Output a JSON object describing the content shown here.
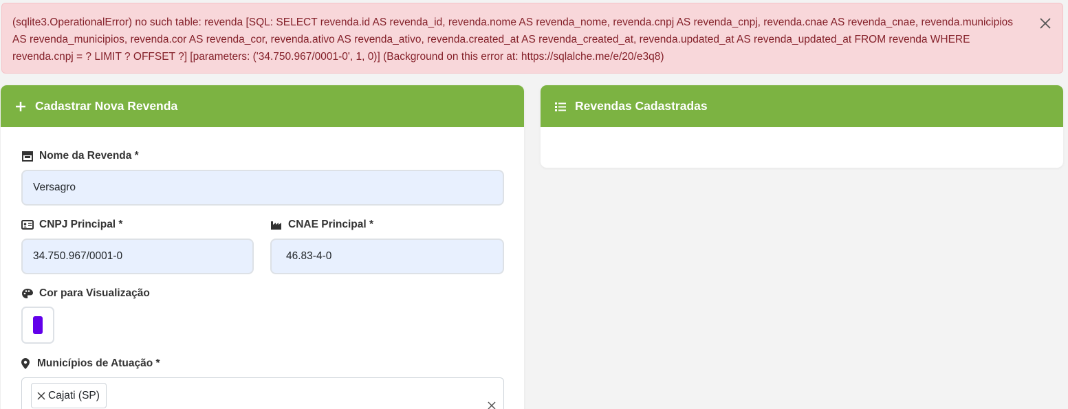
{
  "alert": {
    "message": "(sqlite3.OperationalError) no such table: revenda [SQL: SELECT revenda.id AS revenda_id, revenda.nome AS revenda_nome, revenda.cnpj AS revenda_cnpj, revenda.cnae AS revenda_cnae, revenda.municipios AS revenda_municipios, revenda.cor AS revenda_cor, revenda.ativo AS revenda_ativo, revenda.created_at AS revenda_created_at, revenda.updated_at AS revenda_updated_at FROM revenda WHERE revenda.cnpj = ? LIMIT ? OFFSET ?] [parameters: ('34.750.967/0001-0', 1, 0)] (Background on this error at: https://sqlalche.me/e/20/e3q8)",
    "close_icon": "close-icon"
  },
  "form_card": {
    "title": "Cadastrar Nova Revenda",
    "icon": "plus-icon",
    "fields": {
      "nome": {
        "label": "Nome da Revenda *",
        "value": "Versagro",
        "icon": "store-icon"
      },
      "cnpj": {
        "label": "CNPJ Principal *",
        "value": "34.750.967/0001-0",
        "icon": "id-card-icon"
      },
      "cnae": {
        "label": "CNAE Principal *",
        "value": "46.83-4-0",
        "icon": "industry-icon"
      },
      "cor": {
        "label": "Cor para Visualização",
        "value": "#6200ea",
        "icon": "palette-icon"
      },
      "municipios": {
        "label": "Municípios de Atuação *",
        "selected": [
          "Cajati (SP)"
        ],
        "icon": "map-marker-icon"
      }
    }
  },
  "list_card": {
    "title": "Revendas Cadastradas",
    "icon": "list-icon"
  },
  "colors": {
    "header_green": "#7cb342",
    "alert_bg": "#f8d7da",
    "alert_text": "#842029",
    "input_bg": "#e8f0fe"
  }
}
